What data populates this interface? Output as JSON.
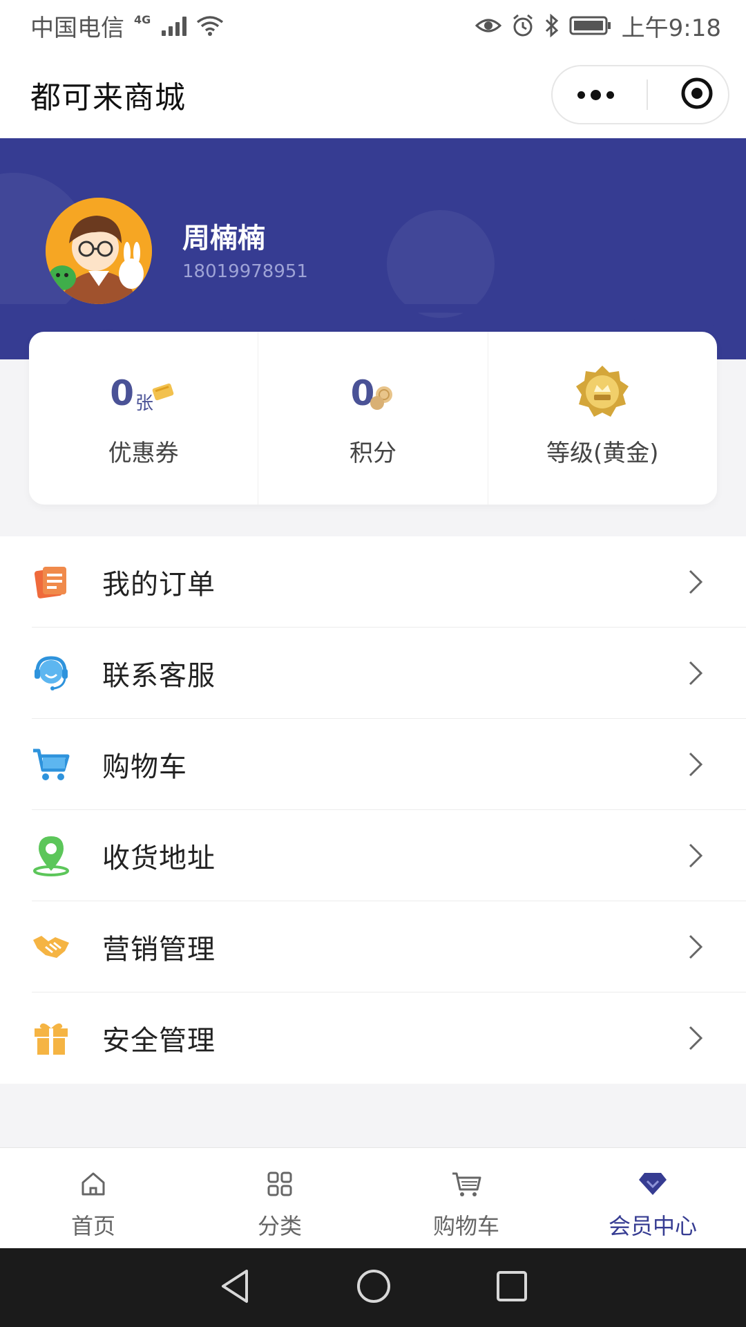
{
  "status_bar": {
    "carrier": "中国电信",
    "network": "4G",
    "time": "上午9:18"
  },
  "title_bar": {
    "title": "都可来商城"
  },
  "profile": {
    "name": "周楠楠",
    "phone": "18019978951"
  },
  "stats": [
    {
      "value": "0",
      "unit": "张",
      "label": "优惠券",
      "icon": "coupon-icon"
    },
    {
      "value": "0",
      "unit": "",
      "label": "积分",
      "icon": "coin-icon"
    },
    {
      "value": "",
      "unit": "",
      "label": "等级(黄金)",
      "icon": "gold-badge-icon"
    }
  ],
  "menu": [
    {
      "label": "我的订单",
      "icon": "order-icon"
    },
    {
      "label": "联系客服",
      "icon": "customer-service-icon"
    },
    {
      "label": "购物车",
      "icon": "cart-icon"
    },
    {
      "label": "收货地址",
      "icon": "location-icon"
    },
    {
      "label": "营销管理",
      "icon": "handshake-icon"
    },
    {
      "label": "安全管理",
      "icon": "gift-icon"
    }
  ],
  "tabs": [
    {
      "label": "首页",
      "icon": "home-icon",
      "active": false
    },
    {
      "label": "分类",
      "icon": "grid-icon",
      "active": false
    },
    {
      "label": "购物车",
      "icon": "cart-icon",
      "active": false
    },
    {
      "label": "会员中心",
      "icon": "diamond-icon",
      "active": true
    }
  ],
  "colors": {
    "primary": "#363c92",
    "header_background": "#363c92",
    "page_background": "#f4f4f6",
    "stat_number": "#4a5296"
  }
}
